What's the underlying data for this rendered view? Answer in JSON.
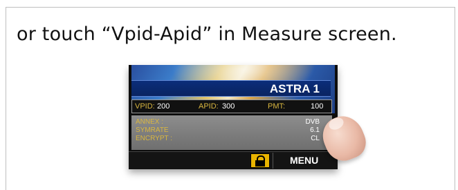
{
  "instruction": "or touch “Vpid-Apid” in Measure screen.",
  "screen": {
    "satellite_name": "ASTRA 1",
    "pids": {
      "vpid_label": "VPID:",
      "vpid_value": "200",
      "apid_label": "APID:",
      "apid_value": "300",
      "pmt_label": "PMT:",
      "pmt_value": "100"
    },
    "info_rows": [
      {
        "key": "ANNEX :",
        "value": "DVB"
      },
      {
        "key": "SYMRATE",
        "value": "6.1"
      },
      {
        "key": "ENCRYPT :",
        "value": "CL"
      }
    ],
    "menu_label": "MENU",
    "lock_icon": "padlock-icon"
  },
  "colors": {
    "title_bar": "#0b2d7a",
    "label_yellow": "#d9b640",
    "lock_yellow": "#e9b400"
  }
}
